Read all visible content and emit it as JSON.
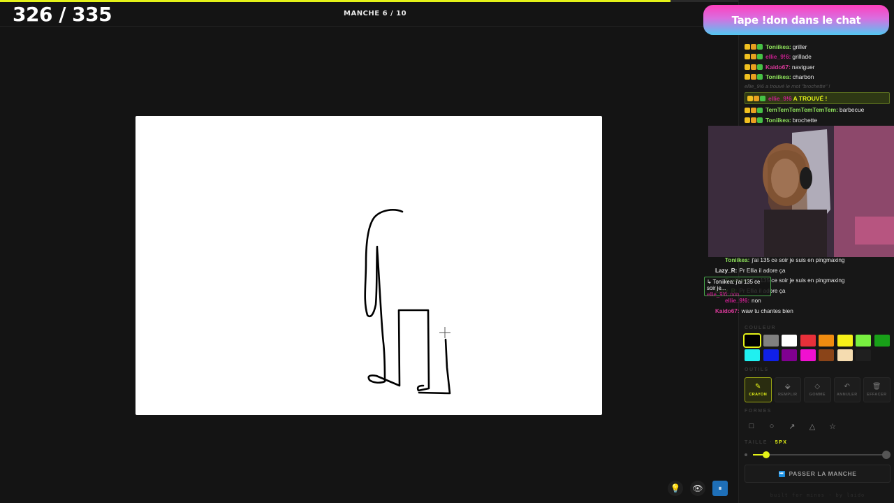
{
  "header": {
    "score": "326 / 335",
    "round": "MANCHE 6 / 10",
    "progress_fraction": 0.75
  },
  "banner": {
    "text": "Tape !don dans le chat"
  },
  "chat": [
    {
      "user": "Toniikea:",
      "msg": "griller",
      "color": "#8fe35c",
      "type": "normal"
    },
    {
      "user": "ellie_9!6:",
      "msg": "grillade",
      "color": "#c9208f",
      "type": "normal"
    },
    {
      "user": "Kaido67:",
      "msg": "naviguer",
      "color": "#d93a9a",
      "type": "normal"
    },
    {
      "user": "Toniikea:",
      "msg": "charbon",
      "color": "#8fe35c",
      "type": "normal"
    },
    {
      "user": "",
      "msg": "ellie_9!6 a trouvé le mot \"brochette\" !",
      "color": "#444444",
      "type": "system"
    },
    {
      "user": "ellie_9!6",
      "msg": "A TROUVÉ !",
      "color": "#c9208f",
      "type": "found"
    },
    {
      "user": "TemTemTemTemTemTem:",
      "msg": "barbecue",
      "color": "#8fe35c",
      "type": "normal"
    },
    {
      "user": "Toniikea:",
      "msg": "brochette",
      "color": "#8fe35c",
      "type": "normal"
    }
  ],
  "overlay_chat": [
    {
      "user": "Toniikea:",
      "msg": "j'ai 135 ce soir je suis en pingmaxing",
      "color": "#8fe35c"
    },
    {
      "user": "Lazy_R:",
      "msg": "Pr Ellia il adore ça",
      "color": "#e8e8e8"
    },
    {
      "user": "Toniikea:",
      "msg": "j'ai 135 ce soir je suis en pingmaxing",
      "color": "#8fe35c"
    },
    {
      "user": "Lazy_R:",
      "msg": "Pr Ellia il adore ça",
      "color": "#8fe35c"
    },
    {
      "user": "ellie_9!6:",
      "msg": "non",
      "color": "#c9208f"
    },
    {
      "user": "Kaido67:",
      "msg": "waw tu chantes bien",
      "color": "#d93a9a"
    }
  ],
  "overlay_box": {
    "line1": "↳ Toniikea: j'ai 135 ce soir je...",
    "line2": "ellie_9!6: non"
  },
  "palette": {
    "label": "COULEUR",
    "colors": [
      "#000000",
      "#808080",
      "#ffffff",
      "#e8303a",
      "#f08c10",
      "#f6f018",
      "#78f040",
      "#18a018",
      "#20f0f0",
      "#1020e8",
      "#800090",
      "#f010d0",
      "#8a4418",
      "#f5dcb0",
      "#1f1f1f"
    ],
    "selected_index": 0
  },
  "tools": {
    "label": "OUTILS",
    "items": [
      {
        "label": "CRAYON",
        "icon": "✎",
        "icon_name": "pencil-icon",
        "active": true
      },
      {
        "label": "REMPLIR",
        "icon": "⬙",
        "icon_name": "fill-bucket-icon",
        "active": false
      },
      {
        "label": "GOMME",
        "icon": "◇",
        "icon_name": "eraser-icon",
        "active": false
      },
      {
        "label": "ANNULER",
        "icon": "↶",
        "icon_name": "undo-icon",
        "active": false
      },
      {
        "label": "EFFACER",
        "icon": "🗑",
        "icon_name": "trash-icon",
        "active": false
      }
    ]
  },
  "shapes": {
    "label": "FORMES",
    "items": [
      {
        "icon": "□",
        "icon_name": "rectangle-icon"
      },
      {
        "icon": "○",
        "icon_name": "ellipse-icon"
      },
      {
        "icon": "↗",
        "icon_name": "arrow-icon"
      },
      {
        "icon": "△",
        "icon_name": "triangle-icon"
      },
      {
        "icon": "☆",
        "icon_name": "star-icon"
      }
    ]
  },
  "size": {
    "label": "TAILLE · ",
    "value": "5PX",
    "fraction": 0.1
  },
  "skip": {
    "label": "PASSER LA MANCHE",
    "icon": "⏭"
  },
  "footer": "built for minos · by laido",
  "bottom_icons": [
    {
      "icon": "💡",
      "icon_name": "hint-bulb-icon"
    },
    {
      "icon": "👁",
      "icon_name": "eye-icon"
    },
    {
      "icon": "⏸",
      "icon_name": "pause-icon"
    }
  ]
}
